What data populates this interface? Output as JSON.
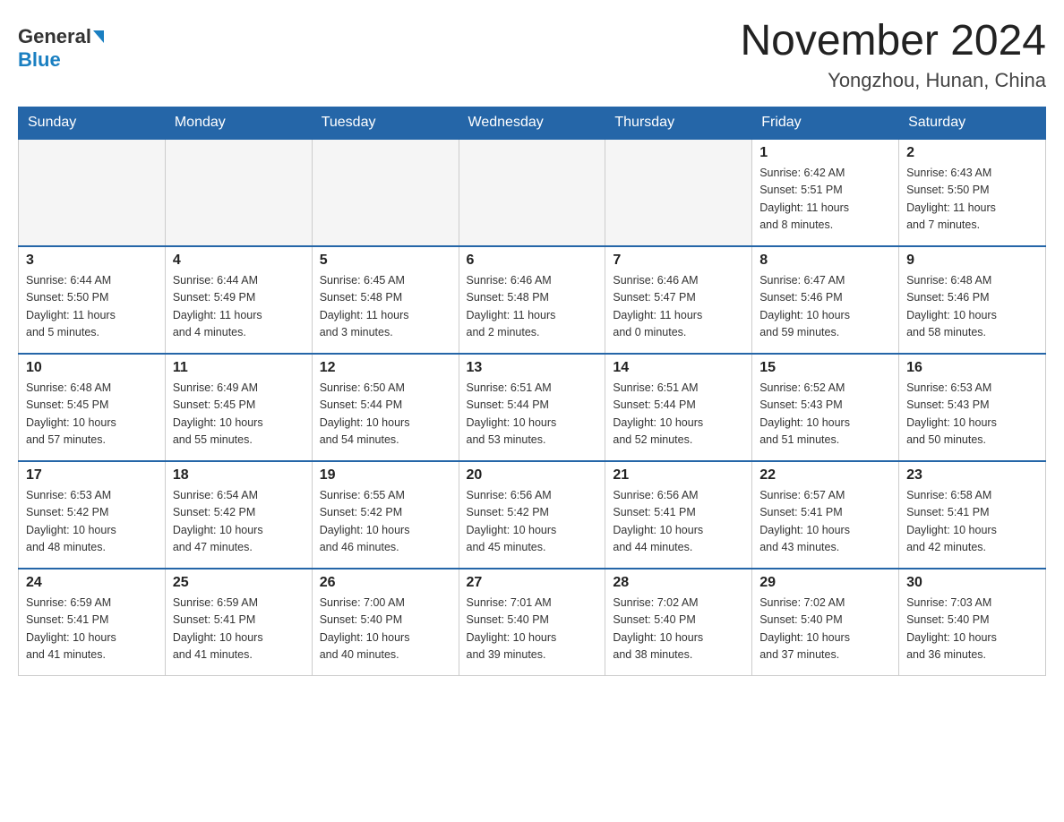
{
  "header": {
    "logo_line1": "General",
    "logo_line2": "Blue",
    "month_year": "November 2024",
    "location": "Yongzhou, Hunan, China"
  },
  "days_of_week": [
    "Sunday",
    "Monday",
    "Tuesday",
    "Wednesday",
    "Thursday",
    "Friday",
    "Saturday"
  ],
  "weeks": [
    [
      {
        "day": "",
        "info": "",
        "empty": true
      },
      {
        "day": "",
        "info": "",
        "empty": true
      },
      {
        "day": "",
        "info": "",
        "empty": true
      },
      {
        "day": "",
        "info": "",
        "empty": true
      },
      {
        "day": "",
        "info": "",
        "empty": true
      },
      {
        "day": "1",
        "info": "Sunrise: 6:42 AM\nSunset: 5:51 PM\nDaylight: 11 hours\nand 8 minutes."
      },
      {
        "day": "2",
        "info": "Sunrise: 6:43 AM\nSunset: 5:50 PM\nDaylight: 11 hours\nand 7 minutes."
      }
    ],
    [
      {
        "day": "3",
        "info": "Sunrise: 6:44 AM\nSunset: 5:50 PM\nDaylight: 11 hours\nand 5 minutes."
      },
      {
        "day": "4",
        "info": "Sunrise: 6:44 AM\nSunset: 5:49 PM\nDaylight: 11 hours\nand 4 minutes."
      },
      {
        "day": "5",
        "info": "Sunrise: 6:45 AM\nSunset: 5:48 PM\nDaylight: 11 hours\nand 3 minutes."
      },
      {
        "day": "6",
        "info": "Sunrise: 6:46 AM\nSunset: 5:48 PM\nDaylight: 11 hours\nand 2 minutes."
      },
      {
        "day": "7",
        "info": "Sunrise: 6:46 AM\nSunset: 5:47 PM\nDaylight: 11 hours\nand 0 minutes."
      },
      {
        "day": "8",
        "info": "Sunrise: 6:47 AM\nSunset: 5:46 PM\nDaylight: 10 hours\nand 59 minutes."
      },
      {
        "day": "9",
        "info": "Sunrise: 6:48 AM\nSunset: 5:46 PM\nDaylight: 10 hours\nand 58 minutes."
      }
    ],
    [
      {
        "day": "10",
        "info": "Sunrise: 6:48 AM\nSunset: 5:45 PM\nDaylight: 10 hours\nand 57 minutes."
      },
      {
        "day": "11",
        "info": "Sunrise: 6:49 AM\nSunset: 5:45 PM\nDaylight: 10 hours\nand 55 minutes."
      },
      {
        "day": "12",
        "info": "Sunrise: 6:50 AM\nSunset: 5:44 PM\nDaylight: 10 hours\nand 54 minutes."
      },
      {
        "day": "13",
        "info": "Sunrise: 6:51 AM\nSunset: 5:44 PM\nDaylight: 10 hours\nand 53 minutes."
      },
      {
        "day": "14",
        "info": "Sunrise: 6:51 AM\nSunset: 5:44 PM\nDaylight: 10 hours\nand 52 minutes."
      },
      {
        "day": "15",
        "info": "Sunrise: 6:52 AM\nSunset: 5:43 PM\nDaylight: 10 hours\nand 51 minutes."
      },
      {
        "day": "16",
        "info": "Sunrise: 6:53 AM\nSunset: 5:43 PM\nDaylight: 10 hours\nand 50 minutes."
      }
    ],
    [
      {
        "day": "17",
        "info": "Sunrise: 6:53 AM\nSunset: 5:42 PM\nDaylight: 10 hours\nand 48 minutes."
      },
      {
        "day": "18",
        "info": "Sunrise: 6:54 AM\nSunset: 5:42 PM\nDaylight: 10 hours\nand 47 minutes."
      },
      {
        "day": "19",
        "info": "Sunrise: 6:55 AM\nSunset: 5:42 PM\nDaylight: 10 hours\nand 46 minutes."
      },
      {
        "day": "20",
        "info": "Sunrise: 6:56 AM\nSunset: 5:42 PM\nDaylight: 10 hours\nand 45 minutes."
      },
      {
        "day": "21",
        "info": "Sunrise: 6:56 AM\nSunset: 5:41 PM\nDaylight: 10 hours\nand 44 minutes."
      },
      {
        "day": "22",
        "info": "Sunrise: 6:57 AM\nSunset: 5:41 PM\nDaylight: 10 hours\nand 43 minutes."
      },
      {
        "day": "23",
        "info": "Sunrise: 6:58 AM\nSunset: 5:41 PM\nDaylight: 10 hours\nand 42 minutes."
      }
    ],
    [
      {
        "day": "24",
        "info": "Sunrise: 6:59 AM\nSunset: 5:41 PM\nDaylight: 10 hours\nand 41 minutes."
      },
      {
        "day": "25",
        "info": "Sunrise: 6:59 AM\nSunset: 5:41 PM\nDaylight: 10 hours\nand 41 minutes."
      },
      {
        "day": "26",
        "info": "Sunrise: 7:00 AM\nSunset: 5:40 PM\nDaylight: 10 hours\nand 40 minutes."
      },
      {
        "day": "27",
        "info": "Sunrise: 7:01 AM\nSunset: 5:40 PM\nDaylight: 10 hours\nand 39 minutes."
      },
      {
        "day": "28",
        "info": "Sunrise: 7:02 AM\nSunset: 5:40 PM\nDaylight: 10 hours\nand 38 minutes."
      },
      {
        "day": "29",
        "info": "Sunrise: 7:02 AM\nSunset: 5:40 PM\nDaylight: 10 hours\nand 37 minutes."
      },
      {
        "day": "30",
        "info": "Sunrise: 7:03 AM\nSunset: 5:40 PM\nDaylight: 10 hours\nand 36 minutes."
      }
    ]
  ]
}
